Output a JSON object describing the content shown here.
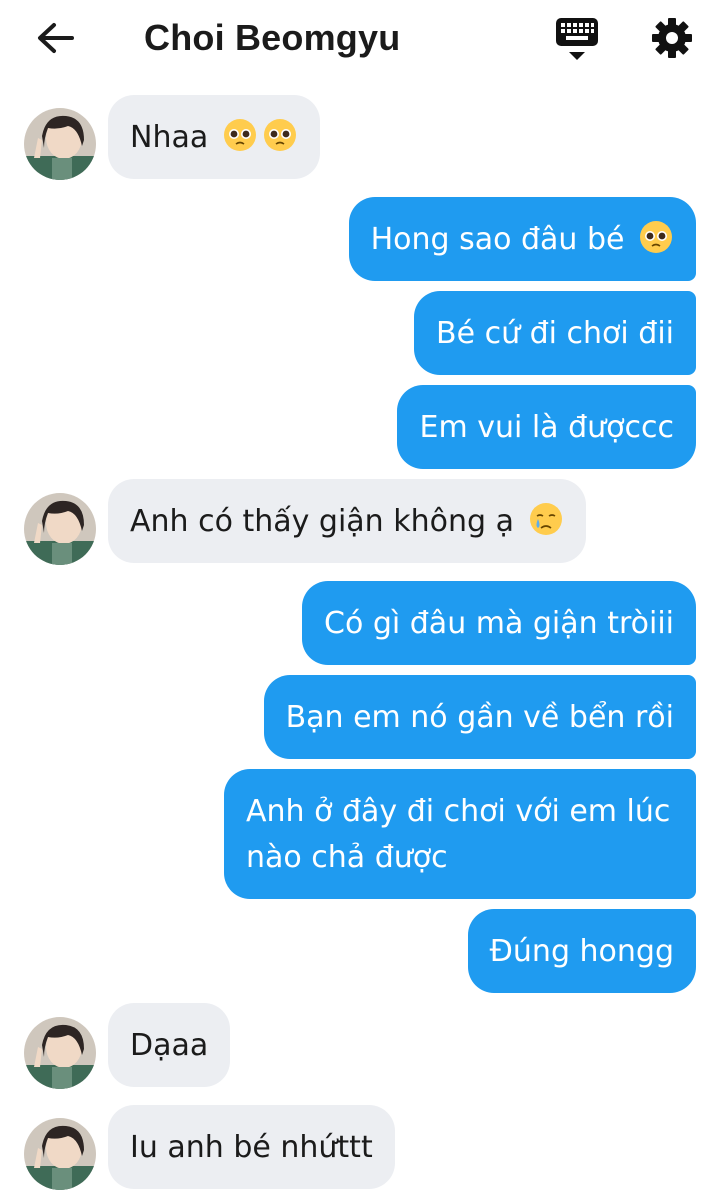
{
  "header": {
    "title": "Choi Beomgyu",
    "back_icon": "arrow-left-icon",
    "keyboard_icon": "keyboard-icon",
    "settings_icon": "gear-icon"
  },
  "colors": {
    "outgoing_bubble": "#1f9bf0",
    "incoming_bubble": "#eceef2",
    "text_dark": "#1b1b1b"
  },
  "messages": [
    {
      "side": "in",
      "text": "Nhaa",
      "emoji": [
        "pleading-face-emoji",
        "pleading-face-emoji"
      ]
    },
    {
      "side": "out",
      "text": "Hong sao đâu bé",
      "emoji": [
        "pleading-face-emoji"
      ]
    },
    {
      "side": "out",
      "text": "Bé cứ đi chơi đii"
    },
    {
      "side": "out",
      "text": "Em vui là đượccc"
    },
    {
      "side": "in",
      "text": "Anh có thấy giận không ạ",
      "emoji": [
        "crying-face-emoji"
      ]
    },
    {
      "side": "out",
      "text": "Có gì đâu mà giận tròiii"
    },
    {
      "side": "out",
      "text": "Bạn em nó gần về bển rồi"
    },
    {
      "side": "out",
      "text": "Anh ở đây đi chơi với em lúc nào chả được"
    },
    {
      "side": "out",
      "text": "Đúng hongg"
    },
    {
      "side": "in",
      "text": "Dạaa"
    },
    {
      "side": "in",
      "text": "Iu anh bé nhứttt"
    }
  ]
}
